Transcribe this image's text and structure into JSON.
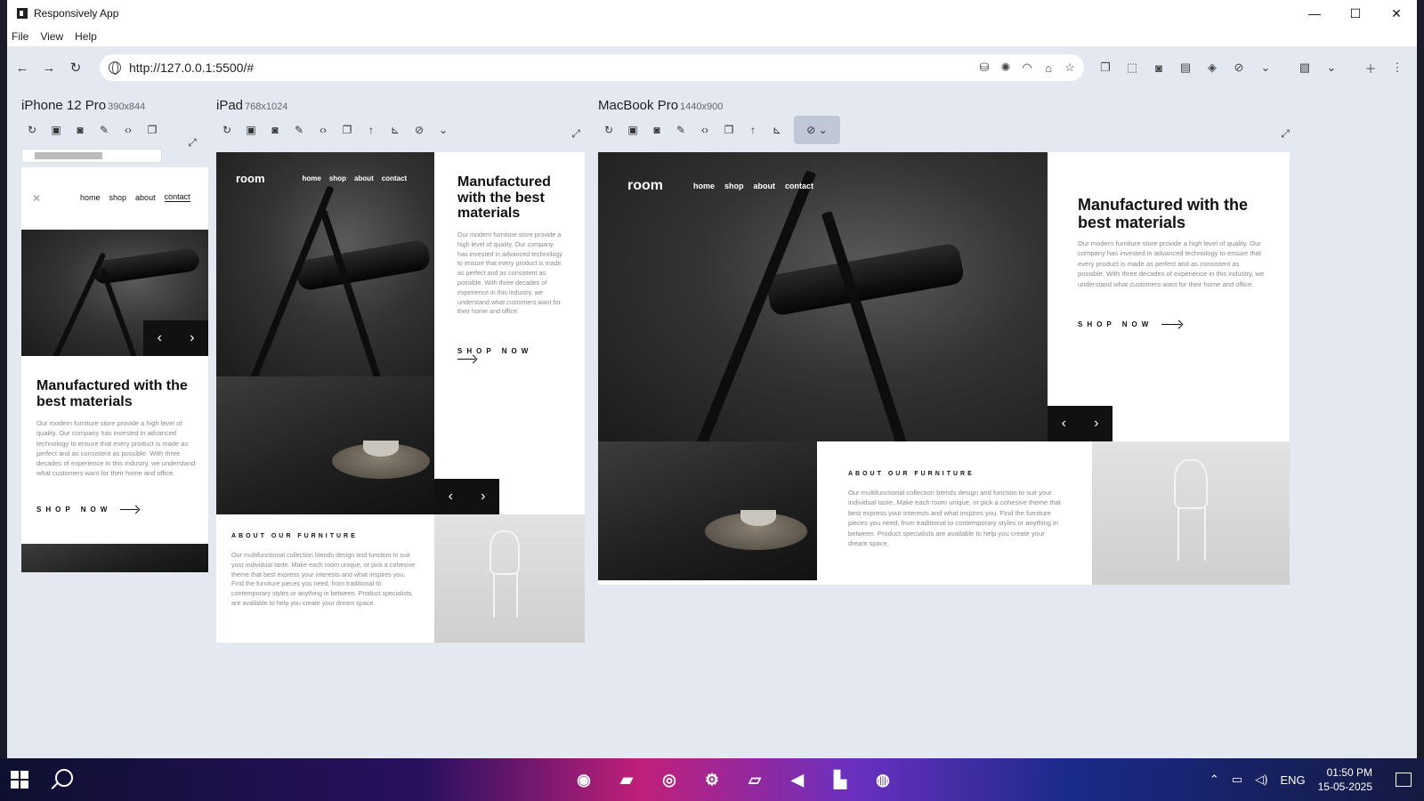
{
  "window": {
    "title": "Responsively App",
    "controls": [
      "—",
      "☐",
      "✕"
    ]
  },
  "menu": [
    "File",
    "View",
    "Help"
  ],
  "address": {
    "url": "http://127.0.0.1:5500/#"
  },
  "devices": {
    "iphone": {
      "name": "iPhone 12 Pro",
      "size": "390x844"
    },
    "ipad": {
      "name": "iPad",
      "size": "768x1024"
    },
    "macbook": {
      "name": "MacBook Pro",
      "size": "1440x900"
    }
  },
  "site": {
    "logo": "room",
    "nav": [
      "home",
      "shop",
      "about",
      "contact"
    ],
    "heading": "Manufactured with the best materials",
    "description": "Our modern furniture store provide a high level of quality. Our company has invested in advanced technology to ensure that every product is made as perfect and as consistent as possible. With three decades of experience in this industry, we understand what customers want for their home and office.",
    "cta": "SHOP NOW",
    "about_title": "ABOUT OUR FURNITURE",
    "about_text": "Our multifunctional collection blends design and function to suit your individual taste. Make each room unique, or pick a cohesive theme that best express your interests and what inspires you. Find the furniture pieces you need, from traditional to contemporary styles or anything in between. Product specialists are available to help you create your dream space.",
    "close_glyph": "✕",
    "prev": "‹",
    "next": "›"
  },
  "taskbar": {
    "lang": "ENG",
    "time": "01:50 PM",
    "date": "15-05-2025"
  },
  "colors": {
    "window_bg": "#e3e8f1",
    "active_tool": "#c0c8d8"
  }
}
